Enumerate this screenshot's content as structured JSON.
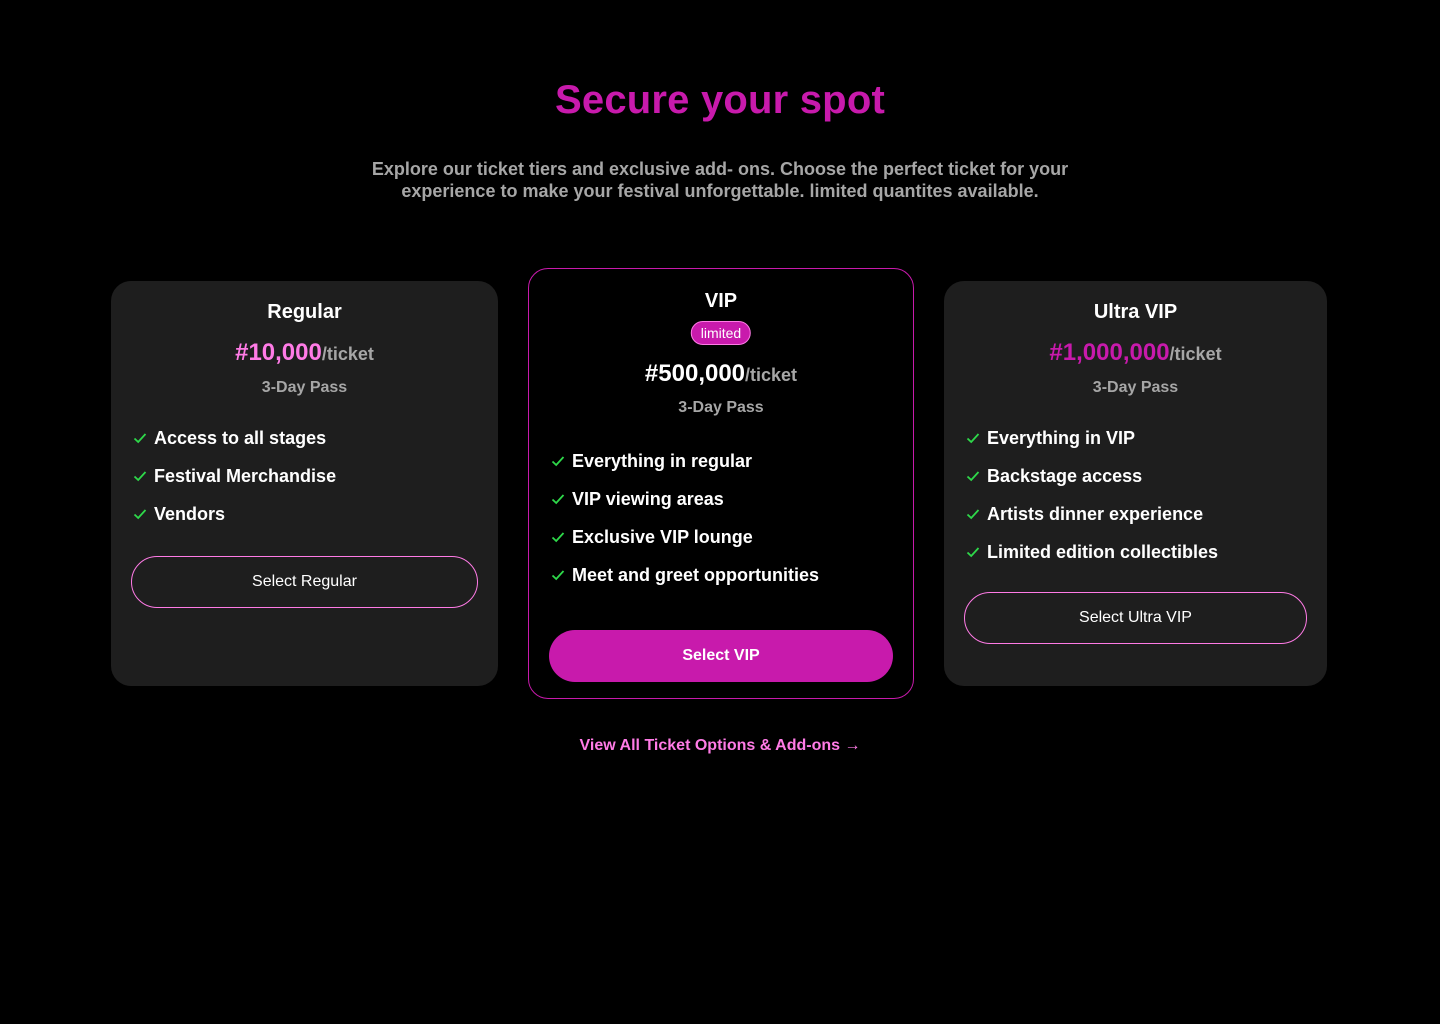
{
  "header": {
    "title": "Secure your spot",
    "subtitle": "Explore our ticket tiers and exclusive add- ons. Choose the perfect ticket for your experience to make your festival unforgettable. limited quantites available."
  },
  "colors": {
    "accent": "#c81aac",
    "accent_light": "#ff7be6",
    "check": "#2ed94a",
    "card_bg": "#1e1e1e",
    "muted_text": "#a6a6a6"
  },
  "tiers": [
    {
      "name": "Regular",
      "price": "#10,000",
      "unit": "/ticket",
      "pass": "3-Day Pass",
      "features": [
        "Access to all stages",
        "Festival Merchandise",
        "Vendors"
      ],
      "button": "Select Regular"
    },
    {
      "name": "VIP",
      "badge": "limited",
      "price": "#500,000",
      "unit": "/ticket",
      "pass": "3-Day Pass",
      "features": [
        "Everything in regular",
        "VIP viewing areas",
        "Exclusive VIP lounge",
        "Meet and greet opportunities"
      ],
      "button": "Select VIP"
    },
    {
      "name": "Ultra VIP",
      "price": "#1,000,000",
      "unit": "/ticket",
      "pass": "3-Day Pass",
      "features": [
        "Everything in VIP",
        "Backstage access",
        "Artists dinner experience",
        "Limited edition collectibles"
      ],
      "button": "Select Ultra VIP"
    }
  ],
  "footer_link": {
    "label": "View All Ticket Options & Add-ons →"
  }
}
